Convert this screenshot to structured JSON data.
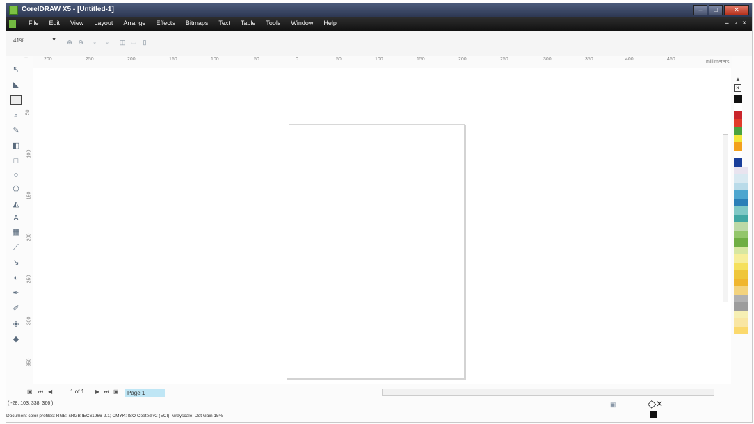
{
  "window": {
    "title": "CorelDRAW X5 - [Untitled-1]",
    "controls": [
      "–",
      "□",
      "✕"
    ],
    "mdi_controls": [
      "–",
      "▫",
      "×"
    ]
  },
  "menubar": {
    "items": [
      "File",
      "Edit",
      "View",
      "Layout",
      "Arrange",
      "Effects",
      "Bitmaps",
      "Text",
      "Table",
      "Tools",
      "Window",
      "Help"
    ]
  },
  "toolbar": {
    "zoom": "41%",
    "icons": [
      "zoom-in-icon",
      "zoom-out-icon",
      "zoom-selected-icon",
      "zoom-all-icon",
      "zoom-page-icon",
      "page-width-icon",
      "page-height-icon"
    ]
  },
  "ruler": {
    "unit": "millimeters",
    "labels": [
      "200",
      "250",
      "200",
      "150",
      "100",
      "50",
      "0",
      "50",
      "100",
      "150",
      "200",
      "250",
      "300",
      "350",
      "400",
      "450"
    ],
    "vertical_labels": [
      "50",
      "100",
      "150",
      "200",
      "250",
      "300",
      "350"
    ]
  },
  "toolbox": {
    "tools": [
      "pick-tool-icon",
      "shape-tool-icon",
      "crop-tool-icon",
      "zoom-tool-icon",
      "freehand-tool-icon",
      "smart-fill-icon",
      "rectangle-tool-icon",
      "ellipse-tool-icon",
      "polygon-tool-icon",
      "basic-shapes-icon",
      "text-tool-icon",
      "table-tool-icon",
      "parallel-dimension-icon",
      "connector-icon",
      "blend-tool-icon",
      "eyedropper-icon",
      "outline-tool-icon",
      "fill-tool-icon",
      "interactive-fill-icon"
    ]
  },
  "palette": {
    "colors": [
      "#111111",
      "#ffffff",
      "#c9242b",
      "#e23b2a",
      "#4aa23e",
      "#f2e63a",
      "#f3a11d",
      "#ffffff",
      "#1a3f9a",
      "#e9e4ef",
      "#d8e9f1",
      "#b9dbe9",
      "#4ea6cf",
      "#2b7fb7",
      "#7fc8c5",
      "#41a7a3",
      "#bcd9a6",
      "#93c66b",
      "#6fae44",
      "#d7e7a1",
      "#f6ee9a",
      "#f5e05c",
      "#efc63a",
      "#f0b62f",
      "#f3d37e",
      "#b1b1b1",
      "#9c9c9c",
      "#f6efb4",
      "#f9e6a3",
      "#fbd96d"
    ]
  },
  "page_nav": {
    "count": "1 of 1",
    "tab": "Page 1"
  },
  "status": {
    "coords": "( -28, 103; 338, 366 )",
    "profiles": "Document color profiles: RGB: sRGB IEC61966-2.1; CMYK: ISO Coated v2 (ECI); Grayscale: Dot Gain 15%"
  },
  "colors": {
    "titlebar": "#3a4764",
    "menubar": "#1e1e1e",
    "page_tab": "#bfe6f5"
  }
}
